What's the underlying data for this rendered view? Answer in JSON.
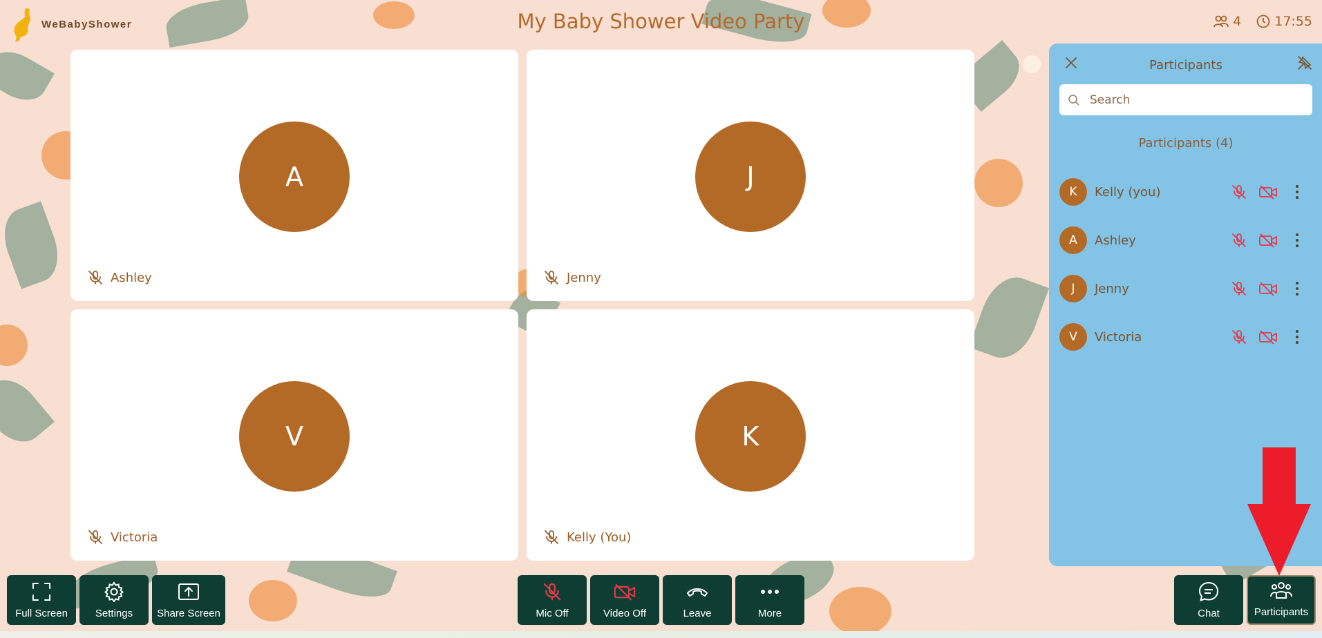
{
  "app": {
    "logo_text": "WeBabyShower",
    "title": "My Baby Shower Video Party",
    "participant_count": "4",
    "clock": "17:55"
  },
  "tiles": [
    {
      "initial": "A",
      "name": "Ashley"
    },
    {
      "initial": "J",
      "name": "Jenny"
    },
    {
      "initial": "V",
      "name": "Victoria"
    },
    {
      "initial": "K",
      "name": "Kelly (You)"
    }
  ],
  "panel": {
    "title": "Participants",
    "search_placeholder": "Search",
    "count_label": "Participants (4)",
    "participants": [
      {
        "initial": "K",
        "name": "Kelly (you)"
      },
      {
        "initial": "A",
        "name": "Ashley"
      },
      {
        "initial": "J",
        "name": "Jenny"
      },
      {
        "initial": "V",
        "name": "Victoria"
      }
    ]
  },
  "toolbar": {
    "full_screen": "Full Screen",
    "settings": "Settings",
    "share_screen": "Share Screen",
    "mic_off": "Mic Off",
    "video_off": "Video Off",
    "leave": "Leave",
    "more": "More",
    "chat": "Chat",
    "participants": "Participants"
  },
  "colors": {
    "avatar": "#b46a27",
    "panel": "#83c3e5",
    "toolbar": "#0e3e33",
    "muted_red": "#e23a4a",
    "arrow": "#ec1c2a",
    "title": "#b5692b"
  }
}
